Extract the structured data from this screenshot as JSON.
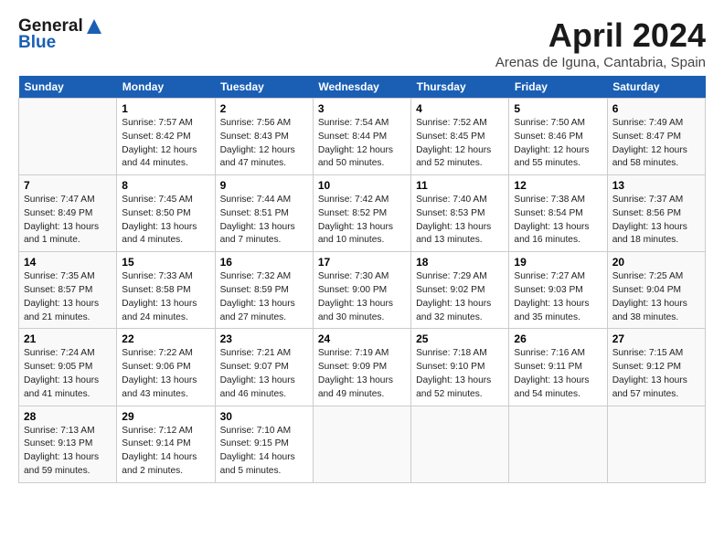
{
  "header": {
    "logo_line1": "General",
    "logo_line2": "Blue",
    "title": "April 2024",
    "subtitle": "Arenas de Iguna, Cantabria, Spain"
  },
  "weekdays": [
    "Sunday",
    "Monday",
    "Tuesday",
    "Wednesday",
    "Thursday",
    "Friday",
    "Saturday"
  ],
  "weeks": [
    [
      {
        "day": "",
        "info": ""
      },
      {
        "day": "1",
        "info": "Sunrise: 7:57 AM\nSunset: 8:42 PM\nDaylight: 12 hours\nand 44 minutes."
      },
      {
        "day": "2",
        "info": "Sunrise: 7:56 AM\nSunset: 8:43 PM\nDaylight: 12 hours\nand 47 minutes."
      },
      {
        "day": "3",
        "info": "Sunrise: 7:54 AM\nSunset: 8:44 PM\nDaylight: 12 hours\nand 50 minutes."
      },
      {
        "day": "4",
        "info": "Sunrise: 7:52 AM\nSunset: 8:45 PM\nDaylight: 12 hours\nand 52 minutes."
      },
      {
        "day": "5",
        "info": "Sunrise: 7:50 AM\nSunset: 8:46 PM\nDaylight: 12 hours\nand 55 minutes."
      },
      {
        "day": "6",
        "info": "Sunrise: 7:49 AM\nSunset: 8:47 PM\nDaylight: 12 hours\nand 58 minutes."
      }
    ],
    [
      {
        "day": "7",
        "info": "Sunrise: 7:47 AM\nSunset: 8:49 PM\nDaylight: 13 hours\nand 1 minute."
      },
      {
        "day": "8",
        "info": "Sunrise: 7:45 AM\nSunset: 8:50 PM\nDaylight: 13 hours\nand 4 minutes."
      },
      {
        "day": "9",
        "info": "Sunrise: 7:44 AM\nSunset: 8:51 PM\nDaylight: 13 hours\nand 7 minutes."
      },
      {
        "day": "10",
        "info": "Sunrise: 7:42 AM\nSunset: 8:52 PM\nDaylight: 13 hours\nand 10 minutes."
      },
      {
        "day": "11",
        "info": "Sunrise: 7:40 AM\nSunset: 8:53 PM\nDaylight: 13 hours\nand 13 minutes."
      },
      {
        "day": "12",
        "info": "Sunrise: 7:38 AM\nSunset: 8:54 PM\nDaylight: 13 hours\nand 16 minutes."
      },
      {
        "day": "13",
        "info": "Sunrise: 7:37 AM\nSunset: 8:56 PM\nDaylight: 13 hours\nand 18 minutes."
      }
    ],
    [
      {
        "day": "14",
        "info": "Sunrise: 7:35 AM\nSunset: 8:57 PM\nDaylight: 13 hours\nand 21 minutes."
      },
      {
        "day": "15",
        "info": "Sunrise: 7:33 AM\nSunset: 8:58 PM\nDaylight: 13 hours\nand 24 minutes."
      },
      {
        "day": "16",
        "info": "Sunrise: 7:32 AM\nSunset: 8:59 PM\nDaylight: 13 hours\nand 27 minutes."
      },
      {
        "day": "17",
        "info": "Sunrise: 7:30 AM\nSunset: 9:00 PM\nDaylight: 13 hours\nand 30 minutes."
      },
      {
        "day": "18",
        "info": "Sunrise: 7:29 AM\nSunset: 9:02 PM\nDaylight: 13 hours\nand 32 minutes."
      },
      {
        "day": "19",
        "info": "Sunrise: 7:27 AM\nSunset: 9:03 PM\nDaylight: 13 hours\nand 35 minutes."
      },
      {
        "day": "20",
        "info": "Sunrise: 7:25 AM\nSunset: 9:04 PM\nDaylight: 13 hours\nand 38 minutes."
      }
    ],
    [
      {
        "day": "21",
        "info": "Sunrise: 7:24 AM\nSunset: 9:05 PM\nDaylight: 13 hours\nand 41 minutes."
      },
      {
        "day": "22",
        "info": "Sunrise: 7:22 AM\nSunset: 9:06 PM\nDaylight: 13 hours\nand 43 minutes."
      },
      {
        "day": "23",
        "info": "Sunrise: 7:21 AM\nSunset: 9:07 PM\nDaylight: 13 hours\nand 46 minutes."
      },
      {
        "day": "24",
        "info": "Sunrise: 7:19 AM\nSunset: 9:09 PM\nDaylight: 13 hours\nand 49 minutes."
      },
      {
        "day": "25",
        "info": "Sunrise: 7:18 AM\nSunset: 9:10 PM\nDaylight: 13 hours\nand 52 minutes."
      },
      {
        "day": "26",
        "info": "Sunrise: 7:16 AM\nSunset: 9:11 PM\nDaylight: 13 hours\nand 54 minutes."
      },
      {
        "day": "27",
        "info": "Sunrise: 7:15 AM\nSunset: 9:12 PM\nDaylight: 13 hours\nand 57 minutes."
      }
    ],
    [
      {
        "day": "28",
        "info": "Sunrise: 7:13 AM\nSunset: 9:13 PM\nDaylight: 13 hours\nand 59 minutes."
      },
      {
        "day": "29",
        "info": "Sunrise: 7:12 AM\nSunset: 9:14 PM\nDaylight: 14 hours\nand 2 minutes."
      },
      {
        "day": "30",
        "info": "Sunrise: 7:10 AM\nSunset: 9:15 PM\nDaylight: 14 hours\nand 5 minutes."
      },
      {
        "day": "",
        "info": ""
      },
      {
        "day": "",
        "info": ""
      },
      {
        "day": "",
        "info": ""
      },
      {
        "day": "",
        "info": ""
      }
    ]
  ]
}
